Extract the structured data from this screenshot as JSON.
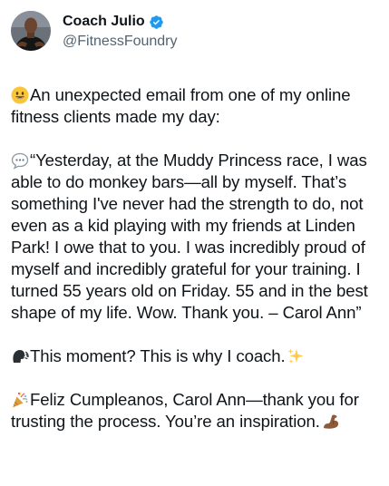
{
  "author": {
    "display_name": "Coach Julio",
    "handle": "@FitnessFoundry",
    "verified": true,
    "avatar_icon": "profile-photo",
    "verified_icon": "verified-badge-icon",
    "verified_color": "#1d9bf0"
  },
  "tweet": {
    "p1_icon": "smiling-face-emoji",
    "p1_text": "An unexpected email from one of my online fitness clients made my day:",
    "p2_icon": "speech-balloon-emoji",
    "p2_text": "“Yesterday, at the Muddy Princess race, I was able to do monkey bars—all by myself. That’s something I've never had the strength to do, not even as a kid playing with my friends at Linden Park! I owe that to you. I was incredibly proud of myself and incredibly grateful for your training. I turned 55 years old on Friday. 55 and in the best shape of my life. Wow. Thank you.  – Carol Ann”",
    "p3_icon": "speaking-head-emoji",
    "p3_text": "This moment? This is why I coach.",
    "p3_trailing_icon": "sparkles-emoji",
    "p4_icon": "party-popper-emoji",
    "p4_text": "Feliz Cumpleanos, Carol Ann—thank you for trusting the process. You’re an inspiration.",
    "p4_trailing_icon": "flexed-biceps-emoji"
  },
  "colors": {
    "text_primary": "#0f1419",
    "text_secondary": "#536471",
    "verified_blue": "#1d9bf0"
  }
}
